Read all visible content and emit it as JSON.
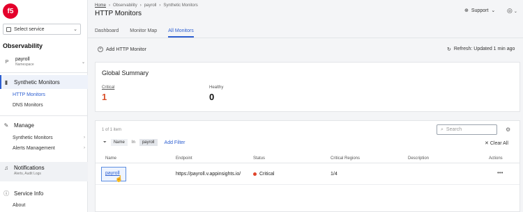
{
  "brand": {
    "logo_text": "f5"
  },
  "sidebar": {
    "service_select": "Select service",
    "section_title": "Observability",
    "namespace": {
      "avatar": "P",
      "name": "payroll",
      "label": "Namespace"
    },
    "synthetic": {
      "label": "Synthetic Monitors",
      "items": [
        {
          "label": "HTTP Monitors"
        },
        {
          "label": "DNS Monitors"
        }
      ]
    },
    "manage": {
      "label": "Manage",
      "items": [
        {
          "label": "Synthetic Monitors"
        },
        {
          "label": "Alerts Management"
        }
      ]
    },
    "notifications": {
      "label": "Notifications",
      "sub": "Alerts, Audit Logs"
    },
    "service_info": {
      "label": "Service Info",
      "items": [
        {
          "label": "About"
        }
      ]
    }
  },
  "header": {
    "breadcrumb": [
      "Home",
      "Observability",
      "payroll",
      "Synthetic Monitors"
    ],
    "title": "HTTP Monitors",
    "support": "Support"
  },
  "tabs": [
    {
      "label": "Dashboard"
    },
    {
      "label": "Monitor Map"
    },
    {
      "label": "All Monitors"
    }
  ],
  "toolbar": {
    "add_label": "Add HTTP Monitor",
    "refresh_label": "Refresh: Updated 1 min ago"
  },
  "summary": {
    "title": "Global Summary",
    "critical_label": "Critical",
    "critical_value": "1",
    "healthy_label": "Healthy",
    "healthy_value": "0"
  },
  "table": {
    "count": "1 of 1 item",
    "search_placeholder": "Search",
    "filter": {
      "field": "Name",
      "op": "In",
      "value": "payroll",
      "add": "Add Filter",
      "clear": "Clear All"
    },
    "columns": [
      "Name",
      "Endpoint",
      "Status",
      "Critical Regions",
      "Description",
      "Actions"
    ],
    "rows": [
      {
        "name": "payroll",
        "endpoint": "https://payroll.v.appinsights.io/",
        "status": "Critical",
        "critical_regions": "1/4",
        "description": "",
        "actions": "•••"
      }
    ]
  },
  "colors": {
    "accent": "#2d5fd1",
    "critical": "#d9502a",
    "brand": "#e4002b"
  }
}
